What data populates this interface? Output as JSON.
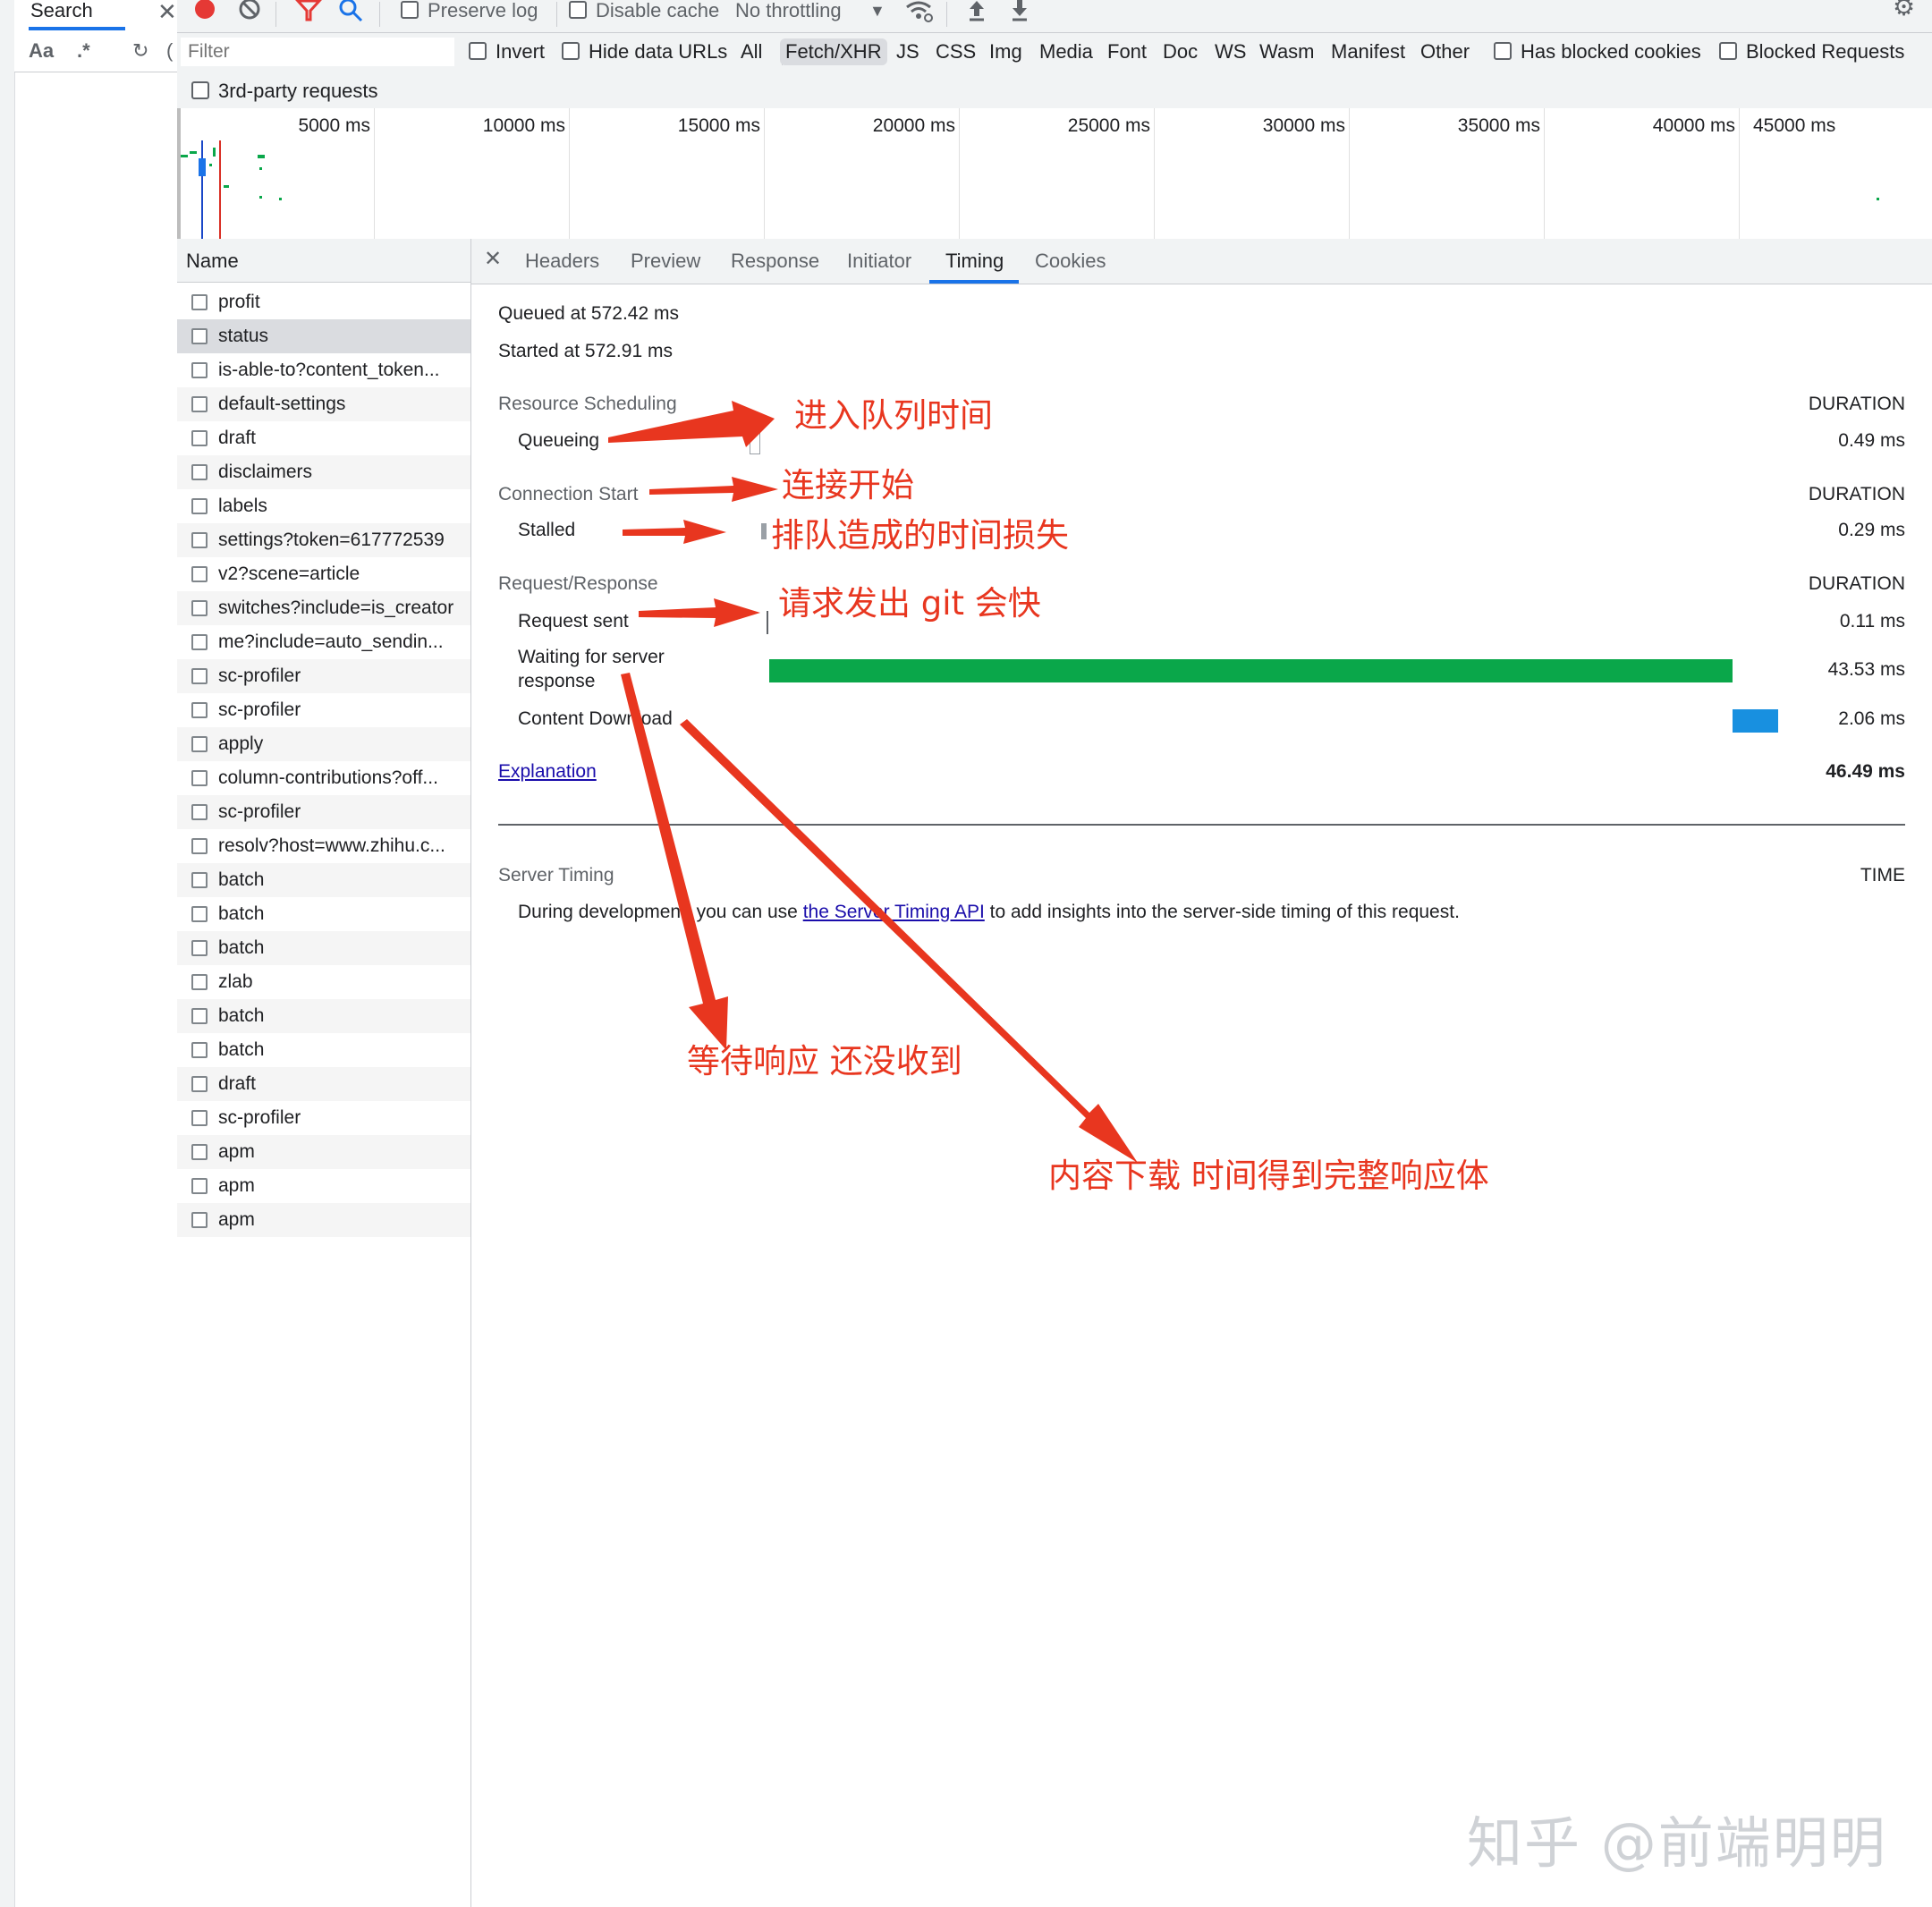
{
  "search_panel": {
    "tab_label": "Search",
    "case_toggle": "Aa",
    "regex_toggle": ".*"
  },
  "toolbar": {
    "preserve_log": "Preserve log",
    "disable_cache": "Disable cache",
    "throttling": "No throttling"
  },
  "filter": {
    "placeholder": "Filter",
    "invert": "Invert",
    "hide_data_urls": "Hide data URLs",
    "types": [
      "All",
      "Fetch/XHR",
      "JS",
      "CSS",
      "Img",
      "Media",
      "Font",
      "Doc",
      "WS",
      "Wasm",
      "Manifest",
      "Other"
    ],
    "active_type": "Fetch/XHR",
    "has_blocked_cookies": "Has blocked cookies",
    "blocked_requests": "Blocked Requests",
    "third_party": "3rd-party requests"
  },
  "overview": {
    "ticks": [
      "5000 ms",
      "10000 ms",
      "15000 ms",
      "20000 ms",
      "25000 ms",
      "30000 ms",
      "35000 ms",
      "40000 ms",
      "45000 ms"
    ]
  },
  "request_list": {
    "header": "Name",
    "items": [
      "profit",
      "status",
      "is-able-to?content_token...",
      "default-settings",
      "draft",
      "disclaimers",
      "labels",
      "settings?token=617772539",
      "v2?scene=article",
      "switches?include=is_creator",
      "me?include=auto_sendin...",
      "sc-profiler",
      "sc-profiler",
      "apply",
      "column-contributions?off...",
      "sc-profiler",
      "resolv?host=www.zhihu.c...",
      "batch",
      "batch",
      "batch",
      "zlab",
      "batch",
      "batch",
      "draft",
      "sc-profiler",
      "apm",
      "apm",
      "apm"
    ],
    "selected": "status"
  },
  "detail": {
    "tabs": [
      "Headers",
      "Preview",
      "Response",
      "Initiator",
      "Timing",
      "Cookies"
    ],
    "active_tab": "Timing",
    "queued_at": "Queued at 572.42 ms",
    "started_at": "Started at 572.91 ms",
    "sections": {
      "scheduling": "Resource Scheduling",
      "connection": "Connection Start",
      "request": "Request/Response",
      "server_timing": "Server Timing"
    },
    "duration_header": "DURATION",
    "time_header": "TIME",
    "rows": {
      "queueing": {
        "label": "Queueing",
        "duration": "0.49 ms"
      },
      "stalled": {
        "label": "Stalled",
        "duration": "0.29 ms"
      },
      "request_sent": {
        "label": "Request sent",
        "duration": "0.11 ms"
      },
      "waiting_line1": "Waiting for server",
      "waiting_line2": "response",
      "waiting_duration": "43.53 ms",
      "download": {
        "label": "Content Download",
        "duration": "2.06 ms"
      }
    },
    "explanation": "Explanation",
    "total": "46.49 ms",
    "server_timing_text_before": "During development, you can use ",
    "server_timing_link": "the Server Timing API",
    "server_timing_text_after": " to add insights into the server-side timing of this request.",
    "colors": {
      "waiting": "#0aa74a",
      "download": "#1890e0"
    }
  },
  "annotations": {
    "queue_time": "进入队列时间",
    "connection_start": "连接开始",
    "stalled_loss": "排队造成的时间损失",
    "request_sent": "请求发出 git 会快",
    "waiting": "等待响应 还没收到",
    "download": "内容下载 时间得到完整响应体"
  },
  "watermark": "知乎 @前端明明"
}
